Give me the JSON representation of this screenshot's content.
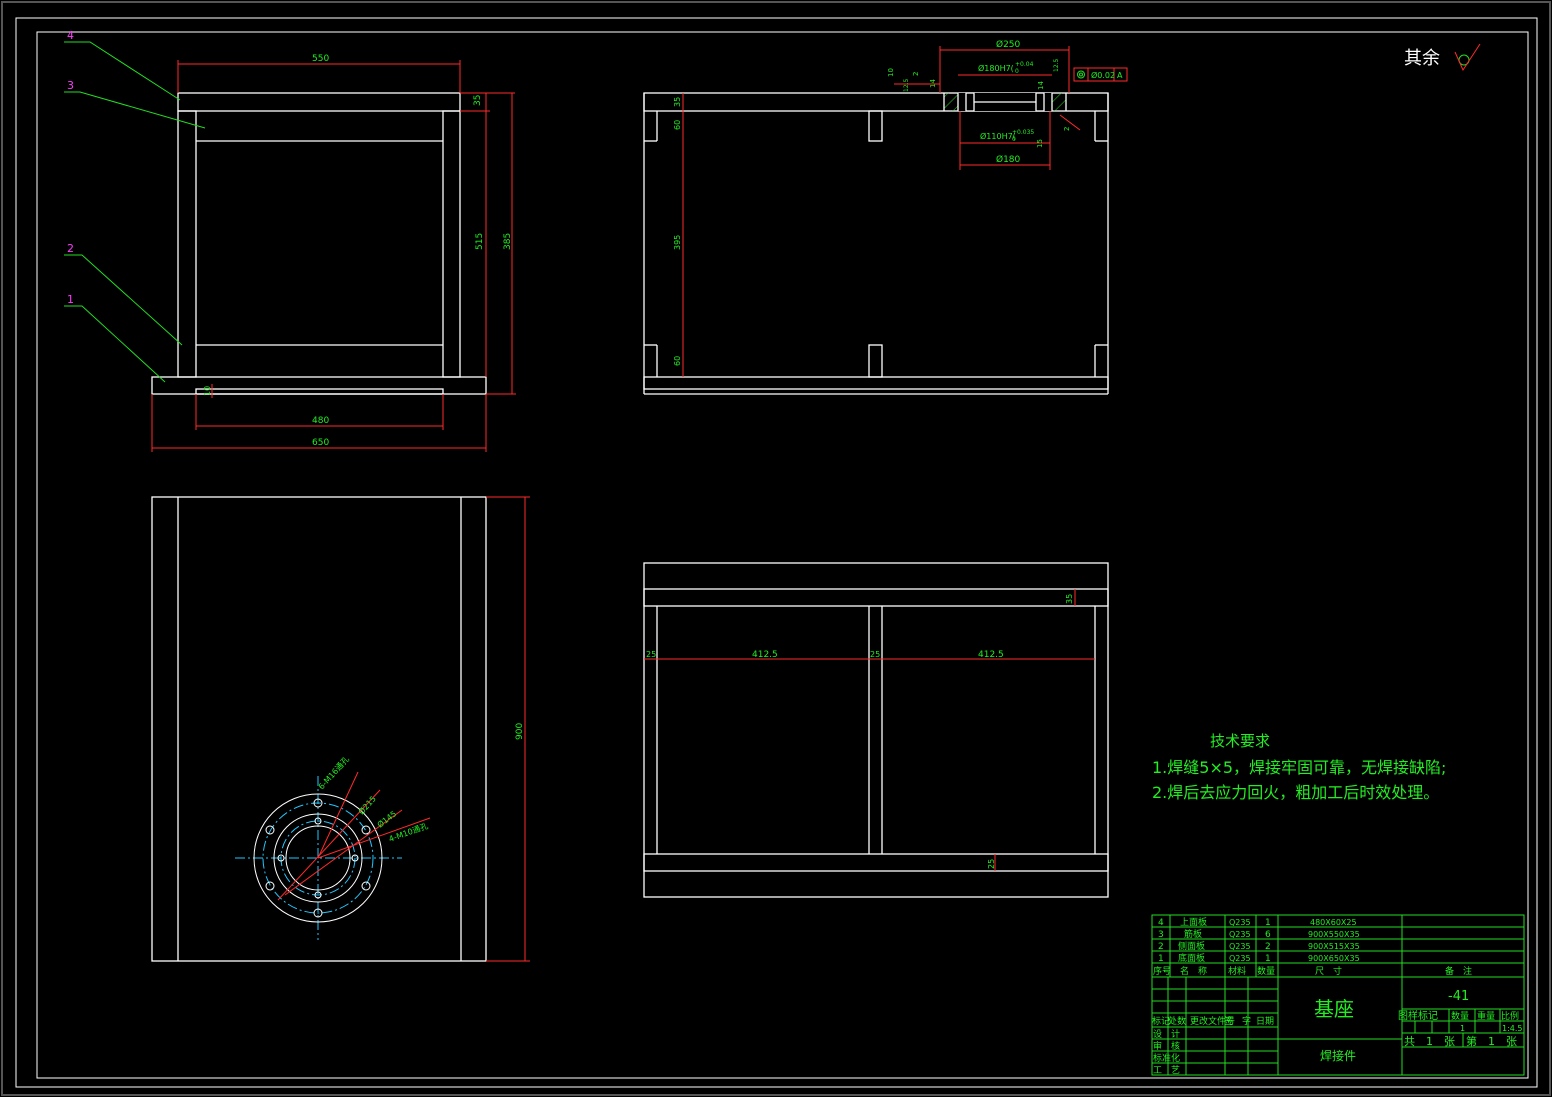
{
  "surface_symbol": "其余",
  "leaders": [
    "4",
    "3",
    "2",
    "1"
  ],
  "dims_front": {
    "top_width": "550",
    "inner_height": "515",
    "total_height": "385",
    "top_thk": "35",
    "bottom_gap": "10",
    "inner_width": "480",
    "base_width": "650"
  },
  "dims_side": {
    "dia_outer": "Ø250",
    "dia_fit_top": "Ø180H7(",
    "tol_top": "+0.04",
    "tol_zero_top": "0",
    "dia_fit_bottom": "Ø110H7(",
    "tol_bottom": "+0.035",
    "tol_zero_bottom": "0",
    "dia_180": "Ø180",
    "small_10": "10",
    "small_2a": "2",
    "small_14a": "14",
    "small_2b": "2",
    "small_14b": "14",
    "small_12": "12.5",
    "small_15": "15",
    "small_12b": "12.5",
    "coax": "Ø0.02",
    "datum": "A",
    "v35": "35",
    "v60a": "60",
    "v395": "395",
    "v60b": "60"
  },
  "dims_plan": {
    "h900": "900",
    "b_6m16": "6-M16通孔",
    "b_215": "Ø215",
    "b_145": "Ø145",
    "b_4m10": "4-M10通孔"
  },
  "dims_bottom": {
    "v35": "35",
    "s25a": "25",
    "s4125a": "412.5",
    "s25b": "25",
    "s4125b": "412.5",
    "v25": "25"
  },
  "tech": {
    "title": "技术要求",
    "line1": "1.焊缝5×5，焊接牢固可靠，无焊接缺陷;",
    "line2": "2.焊后去应力回火，粗加工后时效处理。"
  },
  "bom": [
    {
      "no": "4",
      "name": "上面板",
      "mat": "Q235",
      "qty": "1",
      "size": "480X60X25"
    },
    {
      "no": "3",
      "name": "筋板",
      "mat": "Q235",
      "qty": "6",
      "size": "900X550X35"
    },
    {
      "no": "2",
      "name": "侧面板",
      "mat": "Q235",
      "qty": "2",
      "size": "900X515X35"
    },
    {
      "no": "1",
      "name": "底面板",
      "mat": "Q235",
      "qty": "1",
      "size": "900X650X35"
    }
  ],
  "bom_header": {
    "no": "序号",
    "name": "名　称",
    "mat": "材料",
    "qty": "数量",
    "size": "尺　寸",
    "remark": "备　注"
  },
  "title_block": {
    "part_name": "基座",
    "drawing_no": "-41",
    "weld_part": "焊接件",
    "hdr_chg": "标记",
    "hdr_cnt": "处数",
    "hdr_doc": "更改文件号",
    "hdr_sign": "签　字",
    "hdr_date": "日期",
    "design": "设　计",
    "check": "审　核",
    "std": "标准化",
    "process": "工　艺",
    "stage": "图样标记",
    "count": "数量",
    "weight": "重量",
    "scale_label": "比例",
    "qty_val": "1",
    "scale_val": "1:4.5",
    "total_sheets": "共　1　张",
    "sheet_no": "第　1　张"
  }
}
